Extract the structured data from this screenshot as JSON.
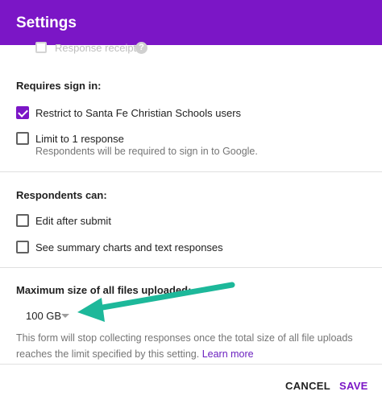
{
  "header": {
    "title": "Settings"
  },
  "faded_item": {
    "label": "Response receipts",
    "help": "?"
  },
  "requires_sign_in": {
    "title": "Requires sign in:",
    "restrict_label": "Restrict to Santa Fe Christian Schools users",
    "restrict_checked": true,
    "limit_label": "Limit to 1 response",
    "limit_checked": false,
    "limit_sub": "Respondents will be required to sign in to Google."
  },
  "respondents_can": {
    "title": "Respondents can:",
    "edit_label": "Edit after submit",
    "edit_checked": false,
    "summary_label": "See summary charts and text responses",
    "summary_checked": false
  },
  "file_upload": {
    "title": "Maximum size of all files uploaded:",
    "selected_size": "100 GB",
    "note": "This form will stop collecting responses once the total size of all file uploads reaches the limit specified by this setting.",
    "learn_more": "Learn more"
  },
  "footer": {
    "cancel_label": "CANCEL",
    "save_label": "SAVE"
  },
  "colors": {
    "accent": "#7b16c6",
    "annotation_arrow": "#1db89a"
  }
}
